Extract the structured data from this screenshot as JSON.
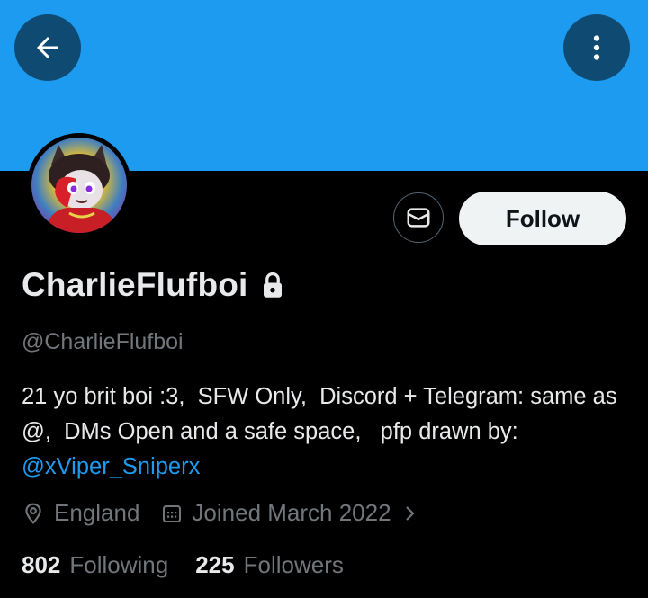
{
  "header": {
    "back_icon": "arrow-left-icon",
    "more_icon": "more-vertical-icon",
    "banner_color": "#1d9bf0"
  },
  "profile": {
    "display_name": "CharlieFlufboi",
    "protected_icon": "lock-icon",
    "handle": "@CharlieFlufboi",
    "bio_text": "21 yo brit boi :3,  SFW Only,  Discord + Telegram: same as @,  DMs Open and a safe space,   pfp drawn by: ",
    "bio_mention": "@xViper_Sniperx",
    "location": "England",
    "joined": "Joined March 2022",
    "following_count": "802",
    "following_label": "Following",
    "followers_count": "225",
    "followers_label": "Followers"
  },
  "actions": {
    "message_icon": "mail-icon",
    "follow_label": "Follow"
  },
  "colors": {
    "accent": "#1d9bf0",
    "background": "#000000",
    "secondary_text": "#71767b"
  }
}
